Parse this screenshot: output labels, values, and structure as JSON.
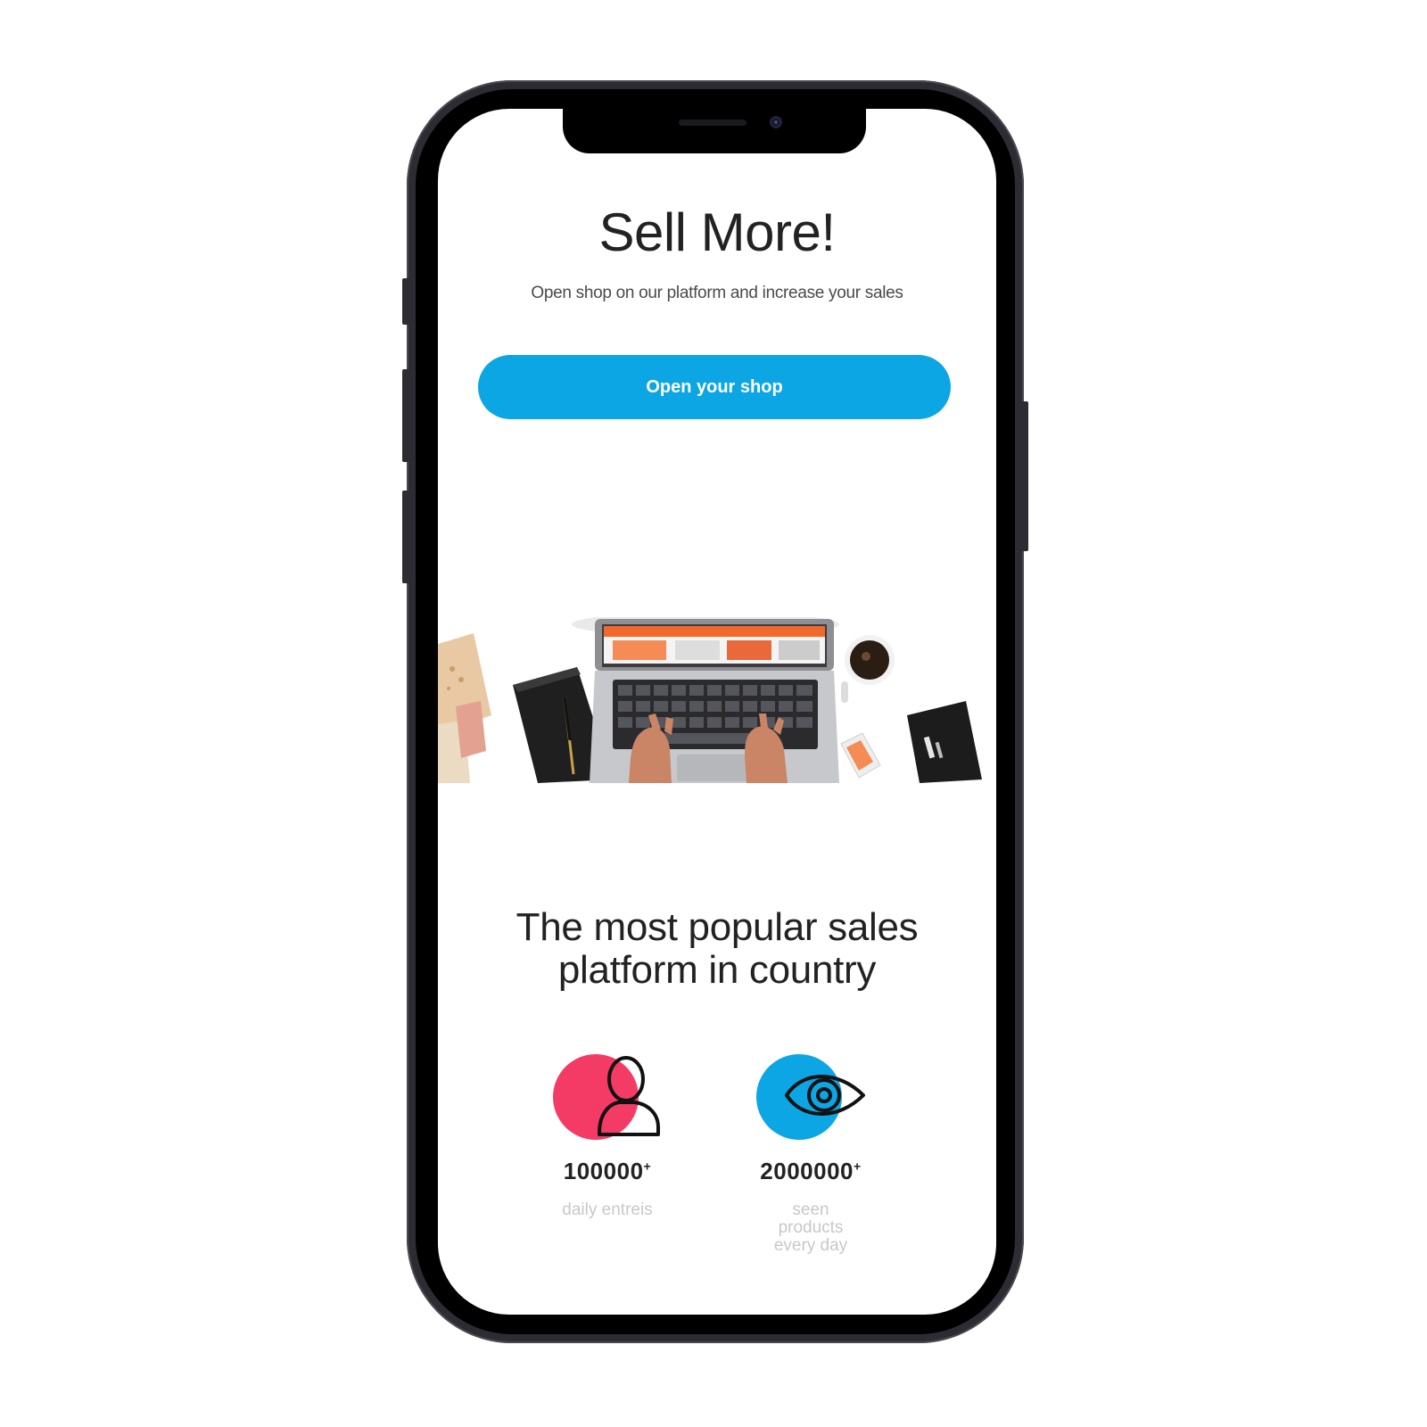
{
  "hero": {
    "title": "Sell More!",
    "subtitle": "Open shop on our platform and increase your sales",
    "cta_label": "Open your shop"
  },
  "section": {
    "title_line1": "The most popular sales",
    "title_line2": "platform in country"
  },
  "stats": [
    {
      "value": "100000",
      "suffix": "+",
      "label_lines": [
        "daily entreis"
      ],
      "icon": "user-icon",
      "accent_color": "#f43b66"
    },
    {
      "value": "2000000",
      "suffix": "+",
      "label_lines": [
        "seen",
        "products",
        "every day"
      ],
      "icon": "eye-icon",
      "accent_color": "#0ba6e3"
    }
  ],
  "colors": {
    "accent": "#0ba6e3",
    "pink": "#f43b66",
    "phone_frame": "#2e2c33"
  }
}
